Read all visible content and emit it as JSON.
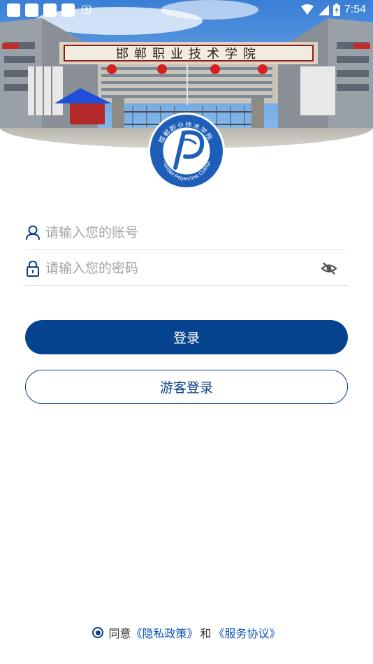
{
  "status_bar": {
    "time": "7:54",
    "notification_letter": "A",
    "icons": [
      "notification-icon",
      "notification-icon",
      "notification-icon",
      "notification-icon",
      "a-icon",
      "wifi-icon",
      "signal-icon",
      "battery-icon"
    ]
  },
  "header": {
    "gate_sign": "邯郸职业技术学院",
    "logo_text_cn": "邯郸职业技术学院",
    "logo_text_en": "Handan Polytechnic College"
  },
  "form": {
    "account_placeholder": "请输入您的账号",
    "account_value": "",
    "password_placeholder": "请输入您的密码",
    "password_value": ""
  },
  "buttons": {
    "login": "登录",
    "guest_login": "游客登录"
  },
  "agreement": {
    "prefix": "同意",
    "privacy_policy": "《隐私政策》",
    "conjunction": "和",
    "service_agreement": "《服务协议》",
    "checked": true
  },
  "colors": {
    "primary": "#06448f",
    "link": "#0a52b8",
    "placeholder": "#a3a3a3",
    "divider": "#e4e4e4"
  }
}
